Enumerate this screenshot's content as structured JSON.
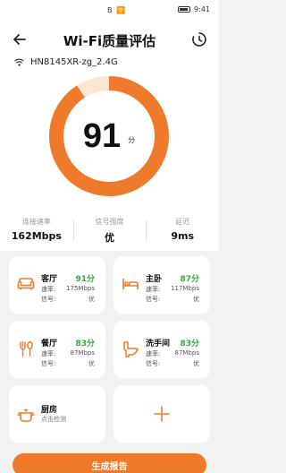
{
  "status_bar": {
    "left_icons": "B 🛜",
    "time": "9:41"
  },
  "header": {
    "title": "Wi-Fi质量评估"
  },
  "network": {
    "ssid": "HN8145XR-zg_2.4G"
  },
  "score": {
    "value": "91",
    "unit": "分",
    "fraction": 0.91
  },
  "accent_color": "#f07a2b",
  "good_color": "#3aa545",
  "stats": [
    {
      "label": "连接速率",
      "value": "162Mbps"
    },
    {
      "label": "信号强度",
      "value": "优"
    },
    {
      "label": "延迟",
      "value": "9ms"
    }
  ],
  "rooms": [
    {
      "name": "客厅",
      "score": "91分",
      "rate_label": "速率:",
      "rate": "175Mbps",
      "signal_label": "信号:",
      "signal": "优",
      "icon": "sofa-icon"
    },
    {
      "name": "主卧",
      "score": "87分",
      "rate_label": "速率:",
      "rate": "117Mbps",
      "signal_label": "信号:",
      "signal": "优",
      "icon": "bed-icon"
    },
    {
      "name": "餐厅",
      "score": "83分",
      "rate_label": "速率:",
      "rate": "87Mbps",
      "signal_label": "信号:",
      "signal": "优",
      "icon": "fork-spoon-icon"
    },
    {
      "name": "洗手间",
      "score": "83分",
      "rate_label": "速率:",
      "rate": "87Mbps",
      "signal_label": "信号:",
      "signal": "优",
      "icon": "toilet-icon"
    }
  ],
  "kitchen": {
    "name": "厨房",
    "sub": "点击检测",
    "icon": "pot-icon"
  },
  "add_room": {
    "icon": "plus-icon"
  },
  "report_button": {
    "label": "生成报告"
  }
}
